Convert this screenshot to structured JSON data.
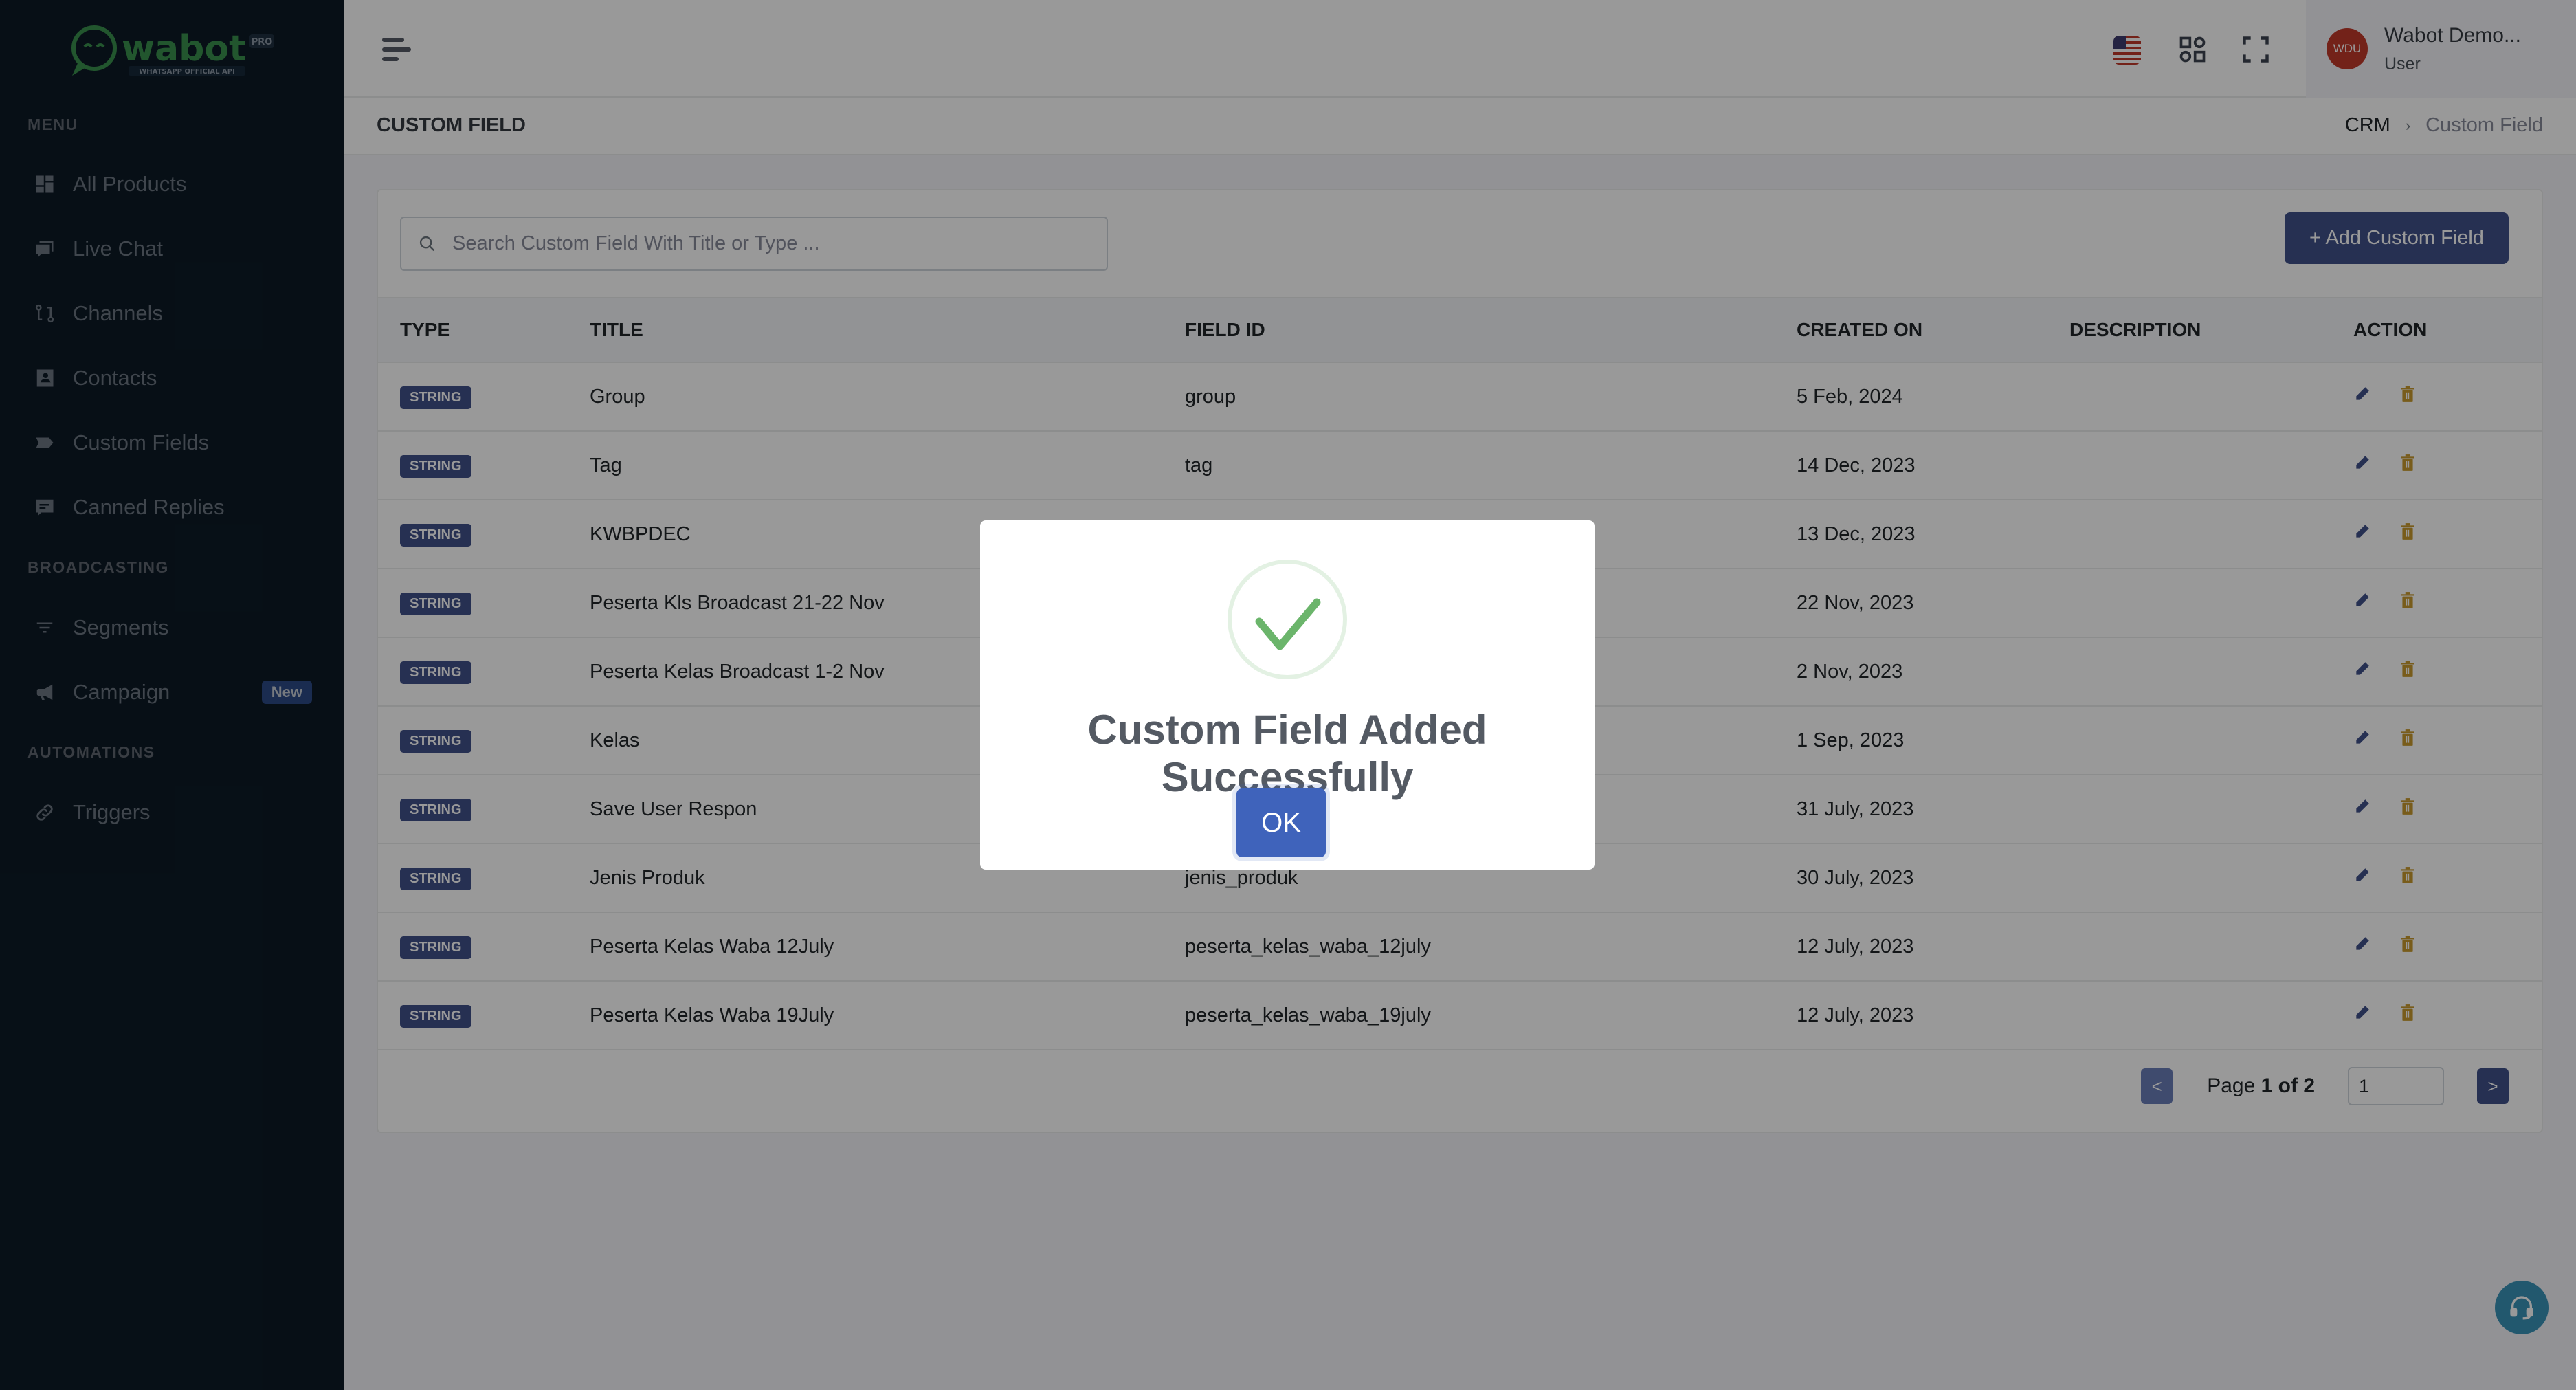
{
  "brand": {
    "name": "wabot",
    "tier": "PRO",
    "tagline": "WHATSAPP OFFICIAL API",
    "color": "#3a8f4e"
  },
  "sidebar": {
    "sections": [
      {
        "label": "MENU",
        "items": [
          {
            "label": "All Products",
            "icon": "grid-icon"
          },
          {
            "label": "Live Chat",
            "icon": "chat-bubbles-icon"
          },
          {
            "label": "Channels",
            "icon": "git-pull-request-icon"
          },
          {
            "label": "Contacts",
            "icon": "contact-book-icon"
          },
          {
            "label": "Custom Fields",
            "icon": "tag-icon"
          },
          {
            "label": "Canned Replies",
            "icon": "message-icon"
          }
        ]
      },
      {
        "label": "BROADCASTING",
        "items": [
          {
            "label": "Segments",
            "icon": "filter-icon"
          },
          {
            "label": "Campaign",
            "icon": "megaphone-icon",
            "badge": "New"
          }
        ]
      },
      {
        "label": "AUTOMATIONS",
        "items": [
          {
            "label": "Triggers",
            "icon": "link-icon"
          }
        ]
      }
    ]
  },
  "header": {
    "language_icon": "us-flag-icon",
    "apps_icon": "apps-grid-icon",
    "fullscreen_icon": "fullscreen-icon",
    "user": {
      "initials": "WDU",
      "name": "Wabot Demo...",
      "role": "User",
      "avatar_color": "#c0392b"
    }
  },
  "page": {
    "title": "CUSTOM FIELD",
    "breadcrumb": [
      "CRM",
      "Custom Field"
    ]
  },
  "toolbar": {
    "search_placeholder": "Search Custom Field With Title or Type ...",
    "search_value": "",
    "add_button": "+ Add Custom Field"
  },
  "table": {
    "columns": [
      "TYPE",
      "TITLE",
      "FIELD ID",
      "CREATED ON",
      "DESCRIPTION",
      "ACTION"
    ],
    "rows": [
      {
        "type": "STRING",
        "title": "Group",
        "field_id": "group",
        "created_on": "5 Feb, 2024",
        "description": ""
      },
      {
        "type": "STRING",
        "title": "Tag",
        "field_id": "tag",
        "created_on": "14 Dec, 2023",
        "description": ""
      },
      {
        "type": "STRING",
        "title": "KWBPDEC",
        "field_id": "",
        "created_on": "13 Dec, 2023",
        "description": ""
      },
      {
        "type": "STRING",
        "title": "Peserta Kls Broadcast 21-22 Nov",
        "field_id": "",
        "created_on": "22 Nov, 2023",
        "description": ""
      },
      {
        "type": "STRING",
        "title": "Peserta Kelas Broadcast 1-2 Nov",
        "field_id": "",
        "created_on": "2 Nov, 2023",
        "description": ""
      },
      {
        "type": "STRING",
        "title": "Kelas",
        "field_id": "",
        "created_on": "1 Sep, 2023",
        "description": ""
      },
      {
        "type": "STRING",
        "title": "Save User Respon",
        "field_id": "",
        "created_on": "31 July, 2023",
        "description": ""
      },
      {
        "type": "STRING",
        "title": "Jenis Produk",
        "field_id": "jenis_produk",
        "created_on": "30 July, 2023",
        "description": ""
      },
      {
        "type": "STRING",
        "title": "Peserta Kelas Waba 12July",
        "field_id": "peserta_kelas_waba_12july",
        "created_on": "12 July, 2023",
        "description": ""
      },
      {
        "type": "STRING",
        "title": "Peserta Kelas Waba 19July",
        "field_id": "peserta_kelas_waba_19july",
        "created_on": "12 July, 2023",
        "description": ""
      }
    ]
  },
  "pagination": {
    "prev": "<",
    "next": ">",
    "label_prefix": "Page",
    "current": "1",
    "of": "of",
    "total": "2",
    "input_value": "1"
  },
  "modal": {
    "icon": "success-check-icon",
    "title": "Custom Field Added Successfully",
    "ok_label": "OK"
  },
  "colors": {
    "sidebar_bg": "#0c1a26",
    "primary": "#405189",
    "edit": "#405189",
    "delete": "#c99a2e",
    "success": "#6bb56b",
    "help_fab": "#3a93b8"
  }
}
